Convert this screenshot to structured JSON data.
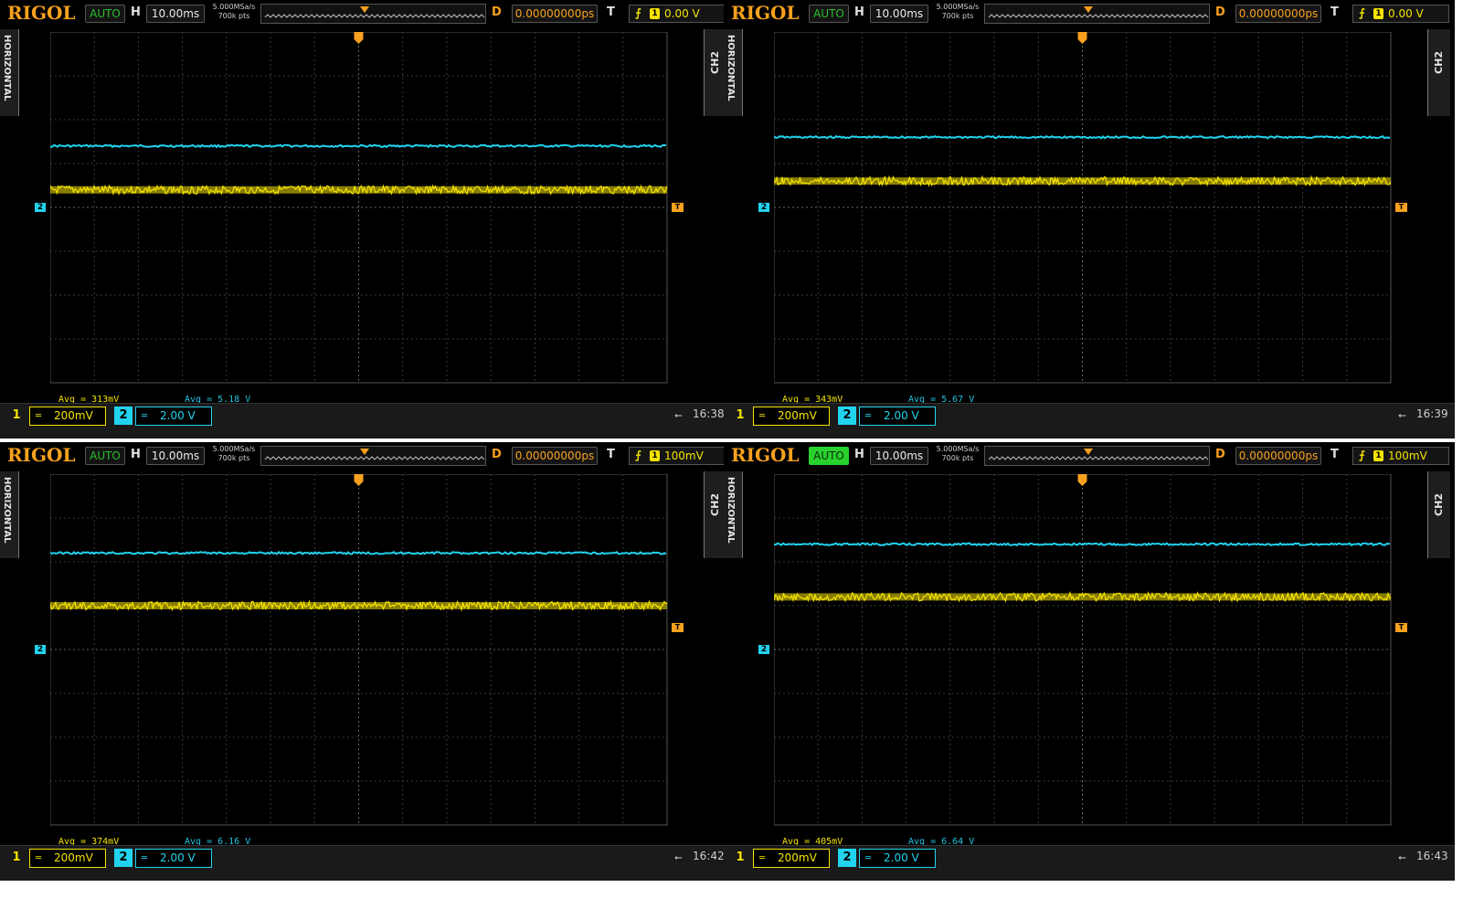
{
  "brand": "RIGOL",
  "screens": [
    {
      "mode": "AUTO",
      "mode_active": false,
      "h_label": "H",
      "timebase": "10.00ms",
      "sample_rate": "5.000MSa/s",
      "memory_depth": "700k pts",
      "delay_label": "D",
      "delay": "0.00000000ps",
      "trigger_label": "T",
      "trigger_source": "1",
      "trigger_level": "0.00 V",
      "side_tab_left": "HORIZONTAL",
      "side_tab_right": "CH2",
      "ch1": {
        "num": "1",
        "coupling": "═",
        "scale": "200mV",
        "avg": "Avg = 313mV"
      },
      "ch2": {
        "num": "2",
        "coupling": "═",
        "scale": "2.00 V",
        "avg": "Avg = 5.18 V"
      },
      "time": "16:38",
      "ch2_ref_marker": "2",
      "trace_levels": {
        "ch2_div": 5.4,
        "ch1_div": 4.4
      },
      "trigger_marker_div": 0
    },
    {
      "mode": "AUTO",
      "mode_active": false,
      "h_label": "H",
      "timebase": "10.00ms",
      "sample_rate": "5.000MSa/s",
      "memory_depth": "700k pts",
      "delay_label": "D",
      "delay": "0.00000000ps",
      "trigger_label": "T",
      "trigger_source": "1",
      "trigger_level": "0.00 V",
      "side_tab_left": "HORIZONTAL",
      "side_tab_right": "CH2",
      "ch1": {
        "num": "1",
        "coupling": "═",
        "scale": "200mV",
        "avg": "Avg = 343mV"
      },
      "ch2": {
        "num": "2",
        "coupling": "═",
        "scale": "2.00 V",
        "avg": "Avg = 5.67 V"
      },
      "time": "16:39",
      "ch2_ref_marker": "2",
      "trace_levels": {
        "ch2_div": 5.6,
        "ch1_div": 4.6
      },
      "trigger_marker_div": 0
    },
    {
      "mode": "AUTO",
      "mode_active": false,
      "h_label": "H",
      "timebase": "10.00ms",
      "sample_rate": "5.000MSa/s",
      "memory_depth": "700k pts",
      "delay_label": "D",
      "delay": "0.00000000ps",
      "trigger_label": "T",
      "trigger_source": "1",
      "trigger_level": "100mV",
      "side_tab_left": "HORIZONTAL",
      "side_tab_right": "CH2",
      "ch1": {
        "num": "1",
        "coupling": "═",
        "scale": "200mV",
        "avg": "Avg = 374mV"
      },
      "ch2": {
        "num": "2",
        "coupling": "═",
        "scale": "2.00 V",
        "avg": "Avg = 6.16 V"
      },
      "time": "16:42",
      "ch2_ref_marker": "2",
      "trace_levels": {
        "ch2_div": 6.2,
        "ch1_div": 5.0
      },
      "trigger_marker_div": 0.5
    },
    {
      "mode": "AUTO",
      "mode_active": true,
      "h_label": "H",
      "timebase": "10.00ms",
      "sample_rate": "5.000MSa/s",
      "memory_depth": "700k pts",
      "delay_label": "D",
      "delay": "0.00000000ps",
      "trigger_label": "T",
      "trigger_source": "1",
      "trigger_level": "100mV",
      "side_tab_left": "HORIZONTAL",
      "side_tab_right": "CH2",
      "ch1": {
        "num": "1",
        "coupling": "═",
        "scale": "200mV",
        "avg": "Avg = 405mV"
      },
      "ch2": {
        "num": "2",
        "coupling": "═",
        "scale": "2.00 V",
        "avg": "Avg = 6.64 V"
      },
      "time": "16:43",
      "ch2_ref_marker": "2",
      "trace_levels": {
        "ch2_div": 6.4,
        "ch1_div": 5.2
      },
      "trigger_marker_div": 0.5
    }
  ],
  "colors": {
    "ch1": "#f5e300",
    "ch2": "#22d3ee",
    "trigger": "#f7a11e",
    "grid": "#3a3a3a"
  }
}
